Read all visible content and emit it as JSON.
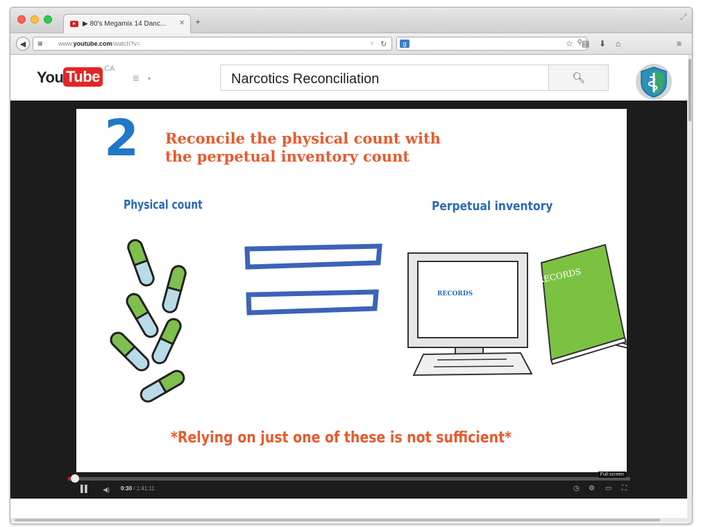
{
  "browser": {
    "tab_title": "▶ 80's Megamix 14 Danc...",
    "tab_close": "✕",
    "new_tab": "+",
    "url_prefix": "www.",
    "url_domain": "youtube.com",
    "url_path": "/watch?v=",
    "search_engine": "g",
    "icons": [
      "back-icon",
      "lock-icon",
      "reload-icon",
      "search-icon",
      "bookmark-star-icon",
      "bookmarks-icon",
      "download-icon",
      "home-icon",
      "menu-icon"
    ]
  },
  "youtube": {
    "logo_you": "You",
    "logo_tube": "Tube",
    "logo_region": "CA",
    "search_query": "Narcotics Reconciliation",
    "brand_color": "#e32625"
  },
  "slide": {
    "step_number": "2",
    "title_line1": "Reconcile the physical count with",
    "title_line2": "the perpetual inventory count",
    "label_physical": "Physical count",
    "label_perpetual": "Perpetual inventory",
    "screen_text": "RECORDS",
    "book_text": "RECORDS",
    "footnote": "*Relying on just one of these is not sufficient*",
    "colors": {
      "title": "#e85a2c",
      "number": "#1f78c8",
      "labels": "#2a6ab8",
      "pill_green": "#7fbf4d",
      "pill_blue": "#b9dbe8",
      "book": "#7cc242"
    }
  },
  "player": {
    "current_time": "0:30",
    "duration": "1:41:11",
    "progress": 0.005,
    "fullscreen_tooltip": "Full screen"
  }
}
